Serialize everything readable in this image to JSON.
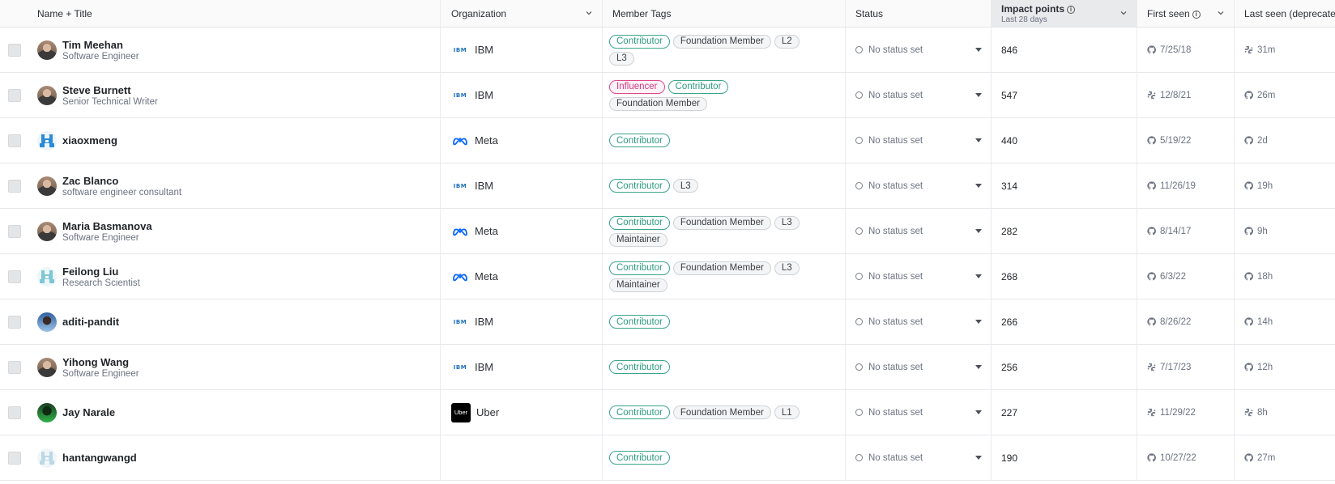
{
  "columns": {
    "name": "Name + Title",
    "organization": "Organization",
    "tags": "Member Tags",
    "status": "Status",
    "impact": "Impact points",
    "impact_sub": "Last 28 days",
    "first_seen": "First seen",
    "last_seen": "Last seen (deprecated)"
  },
  "status_placeholder": "No status set",
  "colors": {
    "contributor": "#2e9a7e",
    "influencer": "#d63a80",
    "ibm_blue": "#1f70c1",
    "meta_blue": "#0866ff"
  },
  "rows": [
    {
      "name": "Tim Meehan",
      "title": "Software Engineer",
      "avatar": "portrait",
      "org": "IBM",
      "org_logo": "ibm-logo",
      "tags": [
        [
          "Contributor",
          "contrib"
        ],
        [
          "Foundation Member",
          ""
        ],
        [
          "L2",
          ""
        ],
        [
          "L3",
          ""
        ]
      ],
      "impact": "846",
      "first_icon": "github-icon",
      "first": "7/25/18",
      "last_icon": "slack-icon",
      "last": "31m"
    },
    {
      "name": "Steve Burnett",
      "title": "Senior Technical Writer",
      "avatar": "portrait",
      "org": "IBM",
      "org_logo": "ibm-logo",
      "tags": [
        [
          "Influencer",
          "influ"
        ],
        [
          "Contributor",
          "contrib"
        ],
        [
          "Foundation Member",
          ""
        ]
      ],
      "impact": "547",
      "first_icon": "slack-icon",
      "first": "12/8/21",
      "last_icon": "github-icon",
      "last": "26m"
    },
    {
      "name": "xiaoxmeng",
      "title": "",
      "avatar": "identicon-blue",
      "org": "Meta",
      "org_logo": "meta-logo",
      "tags": [
        [
          "Contributor",
          "contrib"
        ]
      ],
      "impact": "440",
      "first_icon": "github-icon",
      "first": "5/19/22",
      "last_icon": "github-icon",
      "last": "2d"
    },
    {
      "name": "Zac Blanco",
      "title": "software engineer consultant",
      "avatar": "portrait",
      "org": "IBM",
      "org_logo": "ibm-logo",
      "tags": [
        [
          "Contributor",
          "contrib"
        ],
        [
          "L3",
          ""
        ]
      ],
      "impact": "314",
      "first_icon": "github-icon",
      "first": "11/26/19",
      "last_icon": "github-icon",
      "last": "19h"
    },
    {
      "name": "Maria Basmanova",
      "title": "Software Engineer",
      "avatar": "portrait",
      "org": "Meta",
      "org_logo": "meta-logo",
      "tags": [
        [
          "Contributor",
          "contrib"
        ],
        [
          "Foundation Member",
          ""
        ],
        [
          "L3",
          ""
        ],
        [
          "Maintainer",
          ""
        ]
      ],
      "impact": "282",
      "first_icon": "github-icon",
      "first": "8/14/17",
      "last_icon": "github-icon",
      "last": "9h"
    },
    {
      "name": "Feilong Liu",
      "title": "Research Scientist",
      "avatar": "identicon-teal",
      "org": "Meta",
      "org_logo": "meta-logo",
      "tags": [
        [
          "Contributor",
          "contrib"
        ],
        [
          "Foundation Member",
          ""
        ],
        [
          "L3",
          ""
        ],
        [
          "Maintainer",
          ""
        ]
      ],
      "impact": "268",
      "first_icon": "github-icon",
      "first": "6/3/22",
      "last_icon": "github-icon",
      "last": "18h"
    },
    {
      "name": "aditi-pandit",
      "title": "",
      "avatar": "portrait-sky",
      "org": "IBM",
      "org_logo": "ibm-logo",
      "tags": [
        [
          "Contributor",
          "contrib"
        ]
      ],
      "impact": "266",
      "first_icon": "github-icon",
      "first": "8/26/22",
      "last_icon": "github-icon",
      "last": "14h"
    },
    {
      "name": "Yihong Wang",
      "title": "Software Engineer",
      "avatar": "portrait",
      "org": "IBM",
      "org_logo": "ibm-logo",
      "tags": [
        [
          "Contributor",
          "contrib"
        ]
      ],
      "impact": "256",
      "first_icon": "slack-icon",
      "first": "7/17/23",
      "last_icon": "github-icon",
      "last": "12h"
    },
    {
      "name": "Jay Narale",
      "title": "",
      "avatar": "portrait-green",
      "org": "Uber",
      "org_logo": "uber-logo",
      "org_logo_text": "Uber",
      "tags": [
        [
          "Contributor",
          "contrib"
        ],
        [
          "Foundation Member",
          ""
        ],
        [
          "L1",
          ""
        ]
      ],
      "impact": "227",
      "first_icon": "slack-icon",
      "first": "11/29/22",
      "last_icon": "slack-icon",
      "last": "8h"
    },
    {
      "name": "hantangwangd",
      "title": "",
      "avatar": "identicon-light",
      "org": "",
      "org_logo": "",
      "tags": [
        [
          "Contributor",
          "contrib"
        ]
      ],
      "impact": "190",
      "first_icon": "github-icon",
      "first": "10/27/22",
      "last_icon": "github-icon",
      "last": "27m"
    }
  ]
}
